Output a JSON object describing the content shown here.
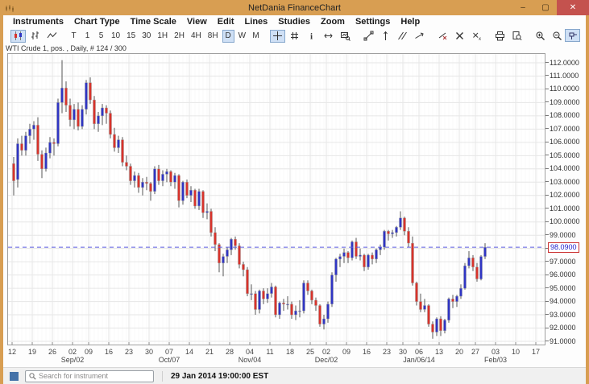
{
  "window": {
    "title": "NetDania FinanceChart",
    "controls": [
      {
        "name": "minimize",
        "glyph": "–"
      },
      {
        "name": "maximize",
        "glyph": "▢"
      },
      {
        "name": "close",
        "glyph": "✕"
      }
    ]
  },
  "menu": {
    "items": [
      "Instruments",
      "Chart Type",
      "Time Scale",
      "View",
      "Edit",
      "Lines",
      "Studies",
      "Zoom",
      "Settings",
      "Help"
    ]
  },
  "toolbar": {
    "groups": [
      {
        "items": [
          {
            "type": "icon",
            "name": "candlestick-chart",
            "active": true
          },
          {
            "type": "icon",
            "name": "ohlc-chart"
          },
          {
            "type": "icon",
            "name": "line-chart"
          }
        ]
      },
      {
        "items": [
          {
            "label": "T"
          },
          {
            "label": "1"
          },
          {
            "label": "5"
          },
          {
            "label": "10"
          },
          {
            "label": "15"
          },
          {
            "label": "30"
          },
          {
            "label": "1H"
          },
          {
            "label": "2H"
          },
          {
            "label": "4H"
          },
          {
            "label": "8H"
          },
          {
            "label": "D",
            "active": true
          },
          {
            "label": "W"
          },
          {
            "label": "M"
          }
        ]
      },
      {
        "items": [
          {
            "type": "icon",
            "name": "crosshair",
            "active": true
          },
          {
            "type": "icon",
            "name": "grid"
          },
          {
            "type": "icon",
            "name": "info"
          },
          {
            "type": "icon",
            "name": "pan"
          },
          {
            "type": "icon",
            "name": "chart-zoom"
          }
        ]
      },
      {
        "items": [
          {
            "type": "icon",
            "name": "trend-line"
          },
          {
            "type": "icon",
            "name": "vertical-line"
          },
          {
            "type": "icon",
            "name": "parallel-lines"
          },
          {
            "type": "icon",
            "name": "ray-line"
          }
        ]
      },
      {
        "items": [
          {
            "type": "icon",
            "name": "delete-line"
          },
          {
            "type": "icon",
            "name": "delete-all"
          },
          {
            "type": "icon",
            "name": "delete-selected"
          }
        ]
      },
      {
        "items": [
          {
            "type": "icon",
            "name": "print"
          },
          {
            "type": "icon",
            "name": "print-preview"
          }
        ]
      },
      {
        "items": [
          {
            "type": "icon",
            "name": "zoom-in"
          },
          {
            "type": "icon",
            "name": "zoom-out"
          },
          {
            "type": "icon",
            "name": "fit-vertical"
          }
        ]
      }
    ],
    "pin": {
      "type": "icon",
      "name": "pin",
      "active": true
    }
  },
  "chart_header": {
    "label": "WTI Crude 1, pos. , Daily, # 124 / 300"
  },
  "chart_data": {
    "type": "candlestick",
    "instrument": "WTI Crude",
    "timeframe": "Daily",
    "bars_shown": "# 124 / 300",
    "ylim": [
      91,
      112
    ],
    "y_step": 1,
    "y_tick_decimals": 4,
    "grid": true,
    "up_color": "#2f35c4",
    "down_color": "#d8332b",
    "wick_color": "#555555",
    "price_line_color": "#5a5adf",
    "current_price": 98.09,
    "current_price_label": "98.0900",
    "ohlc_fields": [
      "open",
      "high",
      "low",
      "close"
    ],
    "bars": [
      [
        104.4,
        104.9,
        102.0,
        103.1
      ],
      [
        103.2,
        106.3,
        102.6,
        105.9
      ],
      [
        105.9,
        106.5,
        105.0,
        105.4
      ],
      [
        105.4,
        106.8,
        105.0,
        106.5
      ],
      [
        106.5,
        107.4,
        105.9,
        107.0
      ],
      [
        107.0,
        107.6,
        106.2,
        107.3
      ],
      [
        107.3,
        107.9,
        104.6,
        105.1
      ],
      [
        105.1,
        105.4,
        103.3,
        104.0
      ],
      [
        104.0,
        105.6,
        103.8,
        105.2
      ],
      [
        105.2,
        106.4,
        104.8,
        106.0
      ],
      [
        106.0,
        106.3,
        105.0,
        105.9
      ],
      [
        105.9,
        109.3,
        105.7,
        109.0
      ],
      [
        109.0,
        112.2,
        108.2,
        110.1
      ],
      [
        110.1,
        110.6,
        108.3,
        108.8
      ],
      [
        108.8,
        109.3,
        107.2,
        107.7
      ],
      [
        107.7,
        108.9,
        107.0,
        108.5
      ],
      [
        108.5,
        109.0,
        106.9,
        107.2
      ],
      [
        107.2,
        108.8,
        107.0,
        108.5
      ],
      [
        108.5,
        110.7,
        108.1,
        110.5
      ],
      [
        110.5,
        110.9,
        108.9,
        109.2
      ],
      [
        109.2,
        109.5,
        107.0,
        107.4
      ],
      [
        107.4,
        108.3,
        106.8,
        108.0
      ],
      [
        108.0,
        108.9,
        107.3,
        108.6
      ],
      [
        108.6,
        108.8,
        107.4,
        108.2
      ],
      [
        108.2,
        108.4,
        106.3,
        106.6
      ],
      [
        106.6,
        107.1,
        105.3,
        105.6
      ],
      [
        105.6,
        106.5,
        105.2,
        106.2
      ],
      [
        106.2,
        106.4,
        104.2,
        104.5
      ],
      [
        104.5,
        105.0,
        103.9,
        104.2
      ],
      [
        104.2,
        104.4,
        102.8,
        103.1
      ],
      [
        103.1,
        103.8,
        102.6,
        103.5
      ],
      [
        103.5,
        103.7,
        102.2,
        102.6
      ],
      [
        102.6,
        103.3,
        102.0,
        103.0
      ],
      [
        103.0,
        103.4,
        102.4,
        102.9
      ],
      [
        102.9,
        103.0,
        101.6,
        102.3
      ],
      [
        102.3,
        104.2,
        102.1,
        104.0
      ],
      [
        104.0,
        104.3,
        102.8,
        103.1
      ],
      [
        103.1,
        103.9,
        102.7,
        103.6
      ],
      [
        103.6,
        104.0,
        103.0,
        103.8
      ],
      [
        103.8,
        103.9,
        102.7,
        103.0
      ],
      [
        103.0,
        103.7,
        102.5,
        103.5
      ],
      [
        103.5,
        103.6,
        101.1,
        101.6
      ],
      [
        101.6,
        103.1,
        101.3,
        103.0
      ],
      [
        103.0,
        103.2,
        101.8,
        102.0
      ],
      [
        102.0,
        102.7,
        101.5,
        102.4
      ],
      [
        102.4,
        102.5,
        101.0,
        101.2
      ],
      [
        101.2,
        102.5,
        100.9,
        102.3
      ],
      [
        102.3,
        102.4,
        100.3,
        100.7
      ],
      [
        100.7,
        101.4,
        100.2,
        100.8
      ],
      [
        100.8,
        101.0,
        98.9,
        99.2
      ],
      [
        99.2,
        99.6,
        97.8,
        98.3
      ],
      [
        98.3,
        98.4,
        96.2,
        96.9
      ],
      [
        96.9,
        97.6,
        95.9,
        97.4
      ],
      [
        97.4,
        98.1,
        96.9,
        97.9
      ],
      [
        97.9,
        98.8,
        97.5,
        98.7
      ],
      [
        98.7,
        98.9,
        97.9,
        98.2
      ],
      [
        98.2,
        98.4,
        96.5,
        96.8
      ],
      [
        96.8,
        97.0,
        95.9,
        96.4
      ],
      [
        96.4,
        96.6,
        94.4,
        94.6
      ],
      [
        94.6,
        95.3,
        94.1,
        94.6
      ],
      [
        94.6,
        94.8,
        93.0,
        93.4
      ],
      [
        93.4,
        94.9,
        93.1,
        94.8
      ],
      [
        94.8,
        95.0,
        93.8,
        94.2
      ],
      [
        94.2,
        95.0,
        93.9,
        94.6
      ],
      [
        94.6,
        95.4,
        94.3,
        95.1
      ],
      [
        95.1,
        95.2,
        92.8,
        93.0
      ],
      [
        93.0,
        94.0,
        92.7,
        93.9
      ],
      [
        93.9,
        94.2,
        93.3,
        93.8
      ],
      [
        93.8,
        94.4,
        93.4,
        93.8
      ],
      [
        93.8,
        94.0,
        92.7,
        93.0
      ],
      [
        93.0,
        93.7,
        92.6,
        93.3
      ],
      [
        93.3,
        94.1,
        92.8,
        93.3
      ],
      [
        93.3,
        95.6,
        93.1,
        95.4
      ],
      [
        95.4,
        95.6,
        94.5,
        94.8
      ],
      [
        94.8,
        94.9,
        93.8,
        94.1
      ],
      [
        94.1,
        94.3,
        93.3,
        93.7
      ],
      [
        93.7,
        93.8,
        92.1,
        92.3
      ],
      [
        92.3,
        93.0,
        91.9,
        92.7
      ],
      [
        92.7,
        94.0,
        92.4,
        93.8
      ],
      [
        93.8,
        96.2,
        93.6,
        96.0
      ],
      [
        96.0,
        97.3,
        95.5,
        97.2
      ],
      [
        97.2,
        97.6,
        96.6,
        97.4
      ],
      [
        97.4,
        98.0,
        96.9,
        97.7
      ],
      [
        97.7,
        97.8,
        96.9,
        97.3
      ],
      [
        97.3,
        98.6,
        97.1,
        98.5
      ],
      [
        98.5,
        98.8,
        97.2,
        97.4
      ],
      [
        97.4,
        98.0,
        97.1,
        97.5
      ],
      [
        97.5,
        97.6,
        96.3,
        96.6
      ],
      [
        96.6,
        97.6,
        96.4,
        97.5
      ],
      [
        97.5,
        97.7,
        96.8,
        97.2
      ],
      [
        97.2,
        98.0,
        96.9,
        97.9
      ],
      [
        97.9,
        98.3,
        97.5,
        98.1
      ],
      [
        98.1,
        99.4,
        97.9,
        99.3
      ],
      [
        99.3,
        99.4,
        98.6,
        99.1
      ],
      [
        99.1,
        99.4,
        98.8,
        99.2
      ],
      [
        99.2,
        99.7,
        98.9,
        99.6
      ],
      [
        99.6,
        100.8,
        99.4,
        100.3
      ],
      [
        100.3,
        100.4,
        99.0,
        99.3
      ],
      [
        99.3,
        99.6,
        98.1,
        98.4
      ],
      [
        98.4,
        98.9,
        95.2,
        95.4
      ],
      [
        95.4,
        95.5,
        93.7,
        94.0
      ],
      [
        94.0,
        94.6,
        93.2,
        93.4
      ],
      [
        93.4,
        94.2,
        93.2,
        93.7
      ],
      [
        93.7,
        93.8,
        92.1,
        92.3
      ],
      [
        92.3,
        92.5,
        91.2,
        91.7
      ],
      [
        91.7,
        92.8,
        91.4,
        92.7
      ],
      [
        92.7,
        92.9,
        91.4,
        91.8
      ],
      [
        91.8,
        92.7,
        91.6,
        92.6
      ],
      [
        92.6,
        94.3,
        92.4,
        94.2
      ],
      [
        94.2,
        94.5,
        93.5,
        94.0
      ],
      [
        94.0,
        94.5,
        93.6,
        94.4
      ],
      [
        94.4,
        95.3,
        94.2,
        95.0
      ],
      [
        95.0,
        96.9,
        94.9,
        96.7
      ],
      [
        96.7,
        97.8,
        96.5,
        97.3
      ],
      [
        97.3,
        97.5,
        96.3,
        96.6
      ],
      [
        96.6,
        96.9,
        95.5,
        95.7
      ],
      [
        95.7,
        97.5,
        95.6,
        97.4
      ],
      [
        97.4,
        98.4,
        97.2,
        98.09
      ]
    ],
    "x_ticks": [
      {
        "label": "12",
        "bar": 0
      },
      {
        "label": "19",
        "bar": 5
      },
      {
        "label": "26",
        "bar": 10
      },
      {
        "label": "02",
        "bar": 15
      },
      {
        "label": "09",
        "bar": 19
      },
      {
        "label": "16",
        "bar": 24
      },
      {
        "label": "23",
        "bar": 29
      },
      {
        "label": "30",
        "bar": 34
      },
      {
        "label": "07",
        "bar": 39
      },
      {
        "label": "14",
        "bar": 44
      },
      {
        "label": "21",
        "bar": 49
      },
      {
        "label": "28",
        "bar": 54
      },
      {
        "label": "04",
        "bar": 59
      },
      {
        "label": "11",
        "bar": 64
      },
      {
        "label": "18",
        "bar": 69
      },
      {
        "label": "25",
        "bar": 74
      },
      {
        "label": "02",
        "bar": 78
      },
      {
        "label": "09",
        "bar": 83
      },
      {
        "label": "16",
        "bar": 88
      },
      {
        "label": "23",
        "bar": 93
      },
      {
        "label": "30",
        "bar": 97
      },
      {
        "label": "06",
        "bar": 101
      },
      {
        "label": "13",
        "bar": 106
      },
      {
        "label": "20",
        "bar": 111
      },
      {
        "label": "27",
        "bar": 115
      },
      {
        "label": "03",
        "bar": 120
      },
      {
        "label": "10",
        "bar": 125
      },
      {
        "label": "17",
        "bar": 130
      }
    ],
    "x_months": [
      {
        "label": "Sep/02",
        "bar": 15
      },
      {
        "label": "Oct/07",
        "bar": 39
      },
      {
        "label": "Nov/04",
        "bar": 59
      },
      {
        "label": "Dec/02",
        "bar": 78
      },
      {
        "label": "Jan/06/14",
        "bar": 101
      },
      {
        "label": "Feb/03",
        "bar": 120
      }
    ]
  },
  "statusbar": {
    "search_placeholder": "Search for instrument",
    "timestamp": "29 Jan 2014 19:00:00 EST"
  },
  "colors": {
    "titlebar": "#d89e52",
    "close_button": "#c4524e",
    "active_button_bg": "#cfe0f5",
    "grid_major": "#e6e6e6",
    "grid_minor": "#f4f4f4"
  }
}
